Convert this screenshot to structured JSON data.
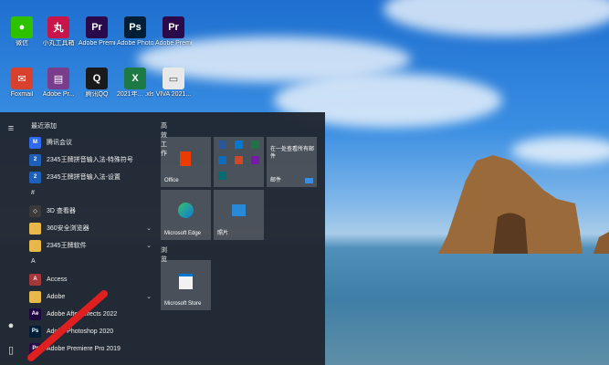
{
  "desktop_icons": [
    {
      "label": "微信",
      "icon": "wechat-icon",
      "color": "#2dc100",
      "glyph": "●"
    },
    {
      "label": "小丸工具箱",
      "icon": "toolbox-icon",
      "color": "#c8164b",
      "glyph": "丸"
    },
    {
      "label": "Adobe Premie...",
      "icon": "premiere-icon",
      "color": "#2a0a4a",
      "glyph": "Pr"
    },
    {
      "label": "Adobe Photosh...",
      "icon": "photoshop-icon",
      "color": "#001e36",
      "glyph": "Ps"
    },
    {
      "label": "Adobe Premie...",
      "icon": "premiere-icon",
      "color": "#2a0a4a",
      "glyph": "Pr"
    },
    {
      "label": "Foxmail",
      "icon": "foxmail-icon",
      "color": "#d9412f",
      "glyph": "✉"
    },
    {
      "label": "Adobe Pr...",
      "icon": "winrar-icon",
      "color": "#7a3d8c",
      "glyph": "▤"
    },
    {
      "label": "腾讯QQ",
      "icon": "qq-icon",
      "color": "#1a1a1a",
      "glyph": "Q"
    },
    {
      "label": "2021年... .xlsx",
      "icon": "excel-file-icon",
      "color": "#1d7a45",
      "glyph": "X"
    },
    {
      "label": "VIVA 2021...",
      "icon": "document-file-icon",
      "color": "#e9e9e9",
      "glyph": "▭"
    }
  ],
  "start_menu": {
    "rail": [
      {
        "icon": "hamburger-icon",
        "glyph": "≡"
      },
      {
        "icon": "user-avatar-icon",
        "glyph": "●"
      },
      {
        "icon": "document-icon",
        "glyph": "▯"
      }
    ],
    "recent_header": "最近添加",
    "apps": [
      {
        "label": "腾讯会议",
        "icon": "tencent-meeting-icon",
        "color": "#2f6bf0",
        "glyph": "M",
        "chev": ""
      },
      {
        "label": "2345王牌拼音输入法-特殊符号",
        "icon": "pinyin-icon",
        "color": "#1f5fb8",
        "glyph": "2",
        "chev": ""
      },
      {
        "label": "2345王牌拼音输入法-设置",
        "icon": "pinyin-icon",
        "color": "#1f5fb8",
        "glyph": "2",
        "chev": ""
      },
      {
        "label": "#",
        "icon": "",
        "color": "",
        "glyph": "",
        "chev": "",
        "group": true
      },
      {
        "label": "3D 查看器",
        "icon": "3d-viewer-icon",
        "color": "#3a3a3a",
        "glyph": "◇",
        "chev": ""
      },
      {
        "label": "360安全浏览器",
        "icon": "folder-icon",
        "color": "#e8b84a",
        "glyph": "",
        "chev": "⌄"
      },
      {
        "label": "2345王牌软件",
        "icon": "folder-icon",
        "color": "#e8b84a",
        "glyph": "",
        "chev": "⌄"
      },
      {
        "label": "A",
        "icon": "",
        "color": "",
        "glyph": "",
        "chev": "",
        "group": true
      },
      {
        "label": "Access",
        "icon": "access-icon",
        "color": "#a4373a",
        "glyph": "A",
        "chev": ""
      },
      {
        "label": "Adobe",
        "icon": "folder-icon",
        "color": "#e8b84a",
        "glyph": "",
        "chev": "⌄"
      },
      {
        "label": "Adobe After Effects 2022",
        "icon": "after-effects-icon",
        "color": "#1f0740",
        "glyph": "Ae",
        "chev": ""
      },
      {
        "label": "Adobe Photoshop 2020",
        "icon": "photoshop-icon",
        "color": "#001e36",
        "glyph": "Ps",
        "chev": ""
      },
      {
        "label": "Adobe Premiere Pro 2019",
        "icon": "premiere-icon",
        "color": "#2a0a4a",
        "glyph": "Pr",
        "chev": ""
      }
    ],
    "tiles_header": "高效工作",
    "browse_header": "浏览",
    "tiles": {
      "office": "Office",
      "mail_note": "在一处查看所有邮件",
      "mail": "邮件",
      "edge": "Microsoft Edge",
      "photos": "照片",
      "store": "Microsoft Store"
    }
  }
}
